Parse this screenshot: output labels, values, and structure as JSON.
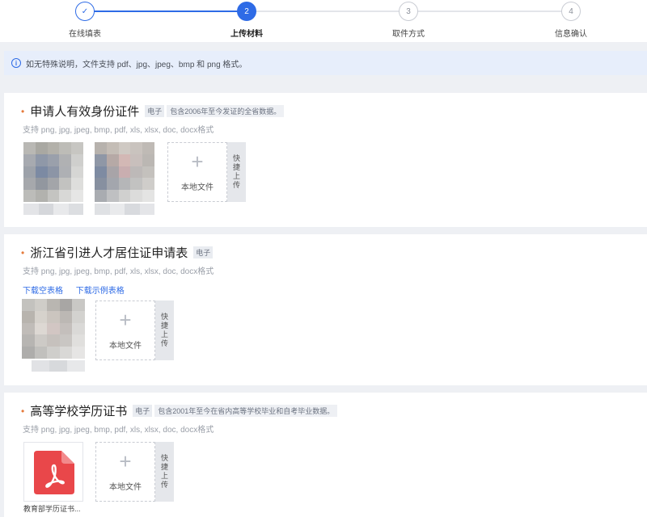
{
  "stepper": {
    "steps": [
      {
        "num": "✓",
        "label": "在线填表",
        "state": "done"
      },
      {
        "num": "2",
        "label": "上传材料",
        "state": "active"
      },
      {
        "num": "3",
        "label": "取件方式",
        "state": "todo"
      },
      {
        "num": "4",
        "label": "信息确认",
        "state": "todo"
      }
    ]
  },
  "notice": {
    "text": "如无特殊说明，文件支持 pdf、jpg、jpeg、bmp 和 png 格式。"
  },
  "sections": [
    {
      "title": "申请人有效身份证件",
      "tag": "电子",
      "hint": "包含2006年至今发证的全省数据。",
      "formats": "支持 png, jpg, jpeg, bmp, pdf, xls, xlsx, doc, docx格式",
      "upload_label": "本地文件",
      "quick_label": "快捷上传"
    },
    {
      "title": "浙江省引进人才居住证申请表",
      "tag": "电子",
      "formats": "支持 png, jpg, jpeg, bmp, pdf, xls, xlsx, doc, docx格式",
      "links": [
        "下载空表格",
        "下载示例表格"
      ],
      "upload_label": "本地文件",
      "quick_label": "快捷上传"
    },
    {
      "title": "高等学校学历证书",
      "tag": "电子",
      "hint": "包含2001年至今在省内高等学校毕业和自考毕业数据。",
      "formats": "支持 png, jpg, jpeg, bmp, pdf, xls, xlsx, doc, docx格式",
      "file_name": "教育部学历证书...",
      "upload_label": "本地文件",
      "quick_label": "快捷上传"
    }
  ],
  "colors": {
    "accent": "#2e6be6",
    "required": "#e57a3b",
    "pdf_red": "#e9474a"
  }
}
